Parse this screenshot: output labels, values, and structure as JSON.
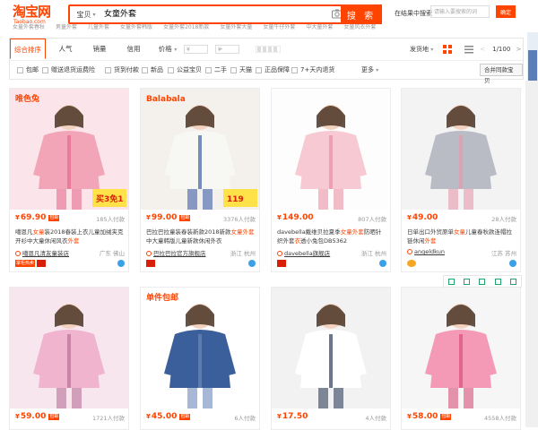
{
  "header": {
    "logo_main": "淘宝网",
    "logo_sub": "Taobao.com",
    "search_type": "宝贝",
    "search_query": "女童外套",
    "search_button": "搜 索",
    "in_results_label": "在结果中搜索",
    "in_results_placeholder": "请输入要搜索的词",
    "confirm": "确定",
    "hot_words": [
      "女童外套春秋",
      "男童外套",
      "儿童外套",
      "女童外套韩版",
      "女童外套2018新款",
      "女童外套大童",
      "女童牛仔外套",
      "中大童外套",
      "女童风衣外套"
    ]
  },
  "sort": {
    "tabs": [
      "综合排序",
      "人气",
      "销量",
      "信用",
      "价格"
    ],
    "price_from": "¥",
    "price_to": "¥",
    "dash": "-",
    "ship_from": "发货地",
    "page": "1/100",
    "prev": "<",
    "next": ">"
  },
  "filters": {
    "checkboxes": [
      "包邮",
      "赠送退货运费险",
      "货到付款",
      "新品",
      "公益宝贝",
      "二手",
      "天猫",
      "正品保障",
      "7+天内退货"
    ],
    "more": "更多",
    "merge": "合并同款宝贝"
  },
  "products": [
    {
      "price": "69.90",
      "free_shipping": "包邮",
      "paid": "185人付款",
      "title_parts": [
        "噶恩凡",
        "女童",
        "装2018春装上衣儿童加绒夹克开衫中大童休闲风衣",
        "外套"
      ],
      "shop": "噶恩凡清友童装店",
      "location": "广东 佛山",
      "badges": [
        "掌柜热卖"
      ],
      "img": {
        "bg": "#fbe5ea",
        "top": "#f3a5b8",
        "accent": "#e56a8f",
        "brand": "唯色兔",
        "promo": "买3免1"
      }
    },
    {
      "price": "99.00",
      "free_shipping": "包邮",
      "paid": "3376人付款",
      "title_parts": [
        "巴拉巴拉童装春装新款2018新款",
        "女童外套",
        "中大童韩版儿童新款休闲外衣",
        ""
      ],
      "shop": "巴拉巴拉官方旗舰店",
      "location": "浙江 杭州",
      "badges": [],
      "img": {
        "bg": "#f4f1ec",
        "top": "#f7f7f4",
        "accent": "#3d5ea8",
        "brand": "Balabala",
        "promo": "119"
      }
    },
    {
      "price": "149.00",
      "free_shipping": "",
      "paid": "807人付款",
      "title_parts": [
        "davebella戴维贝拉夏季",
        "女童外套",
        "防晒针织外套",
        "衣",
        "透小兔包DB5362"
      ],
      "shop": "davebella旗舰店",
      "location": "浙江 杭州",
      "badges": [],
      "img": {
        "bg": "#fdfdfd",
        "top": "#f6c9d3",
        "accent": "#ea8fa3",
        "brand": "",
        "promo": ""
      }
    },
    {
      "price": "49.00",
      "free_shipping": "",
      "paid": "28人付款",
      "title_parts": [
        "日单出口外贸原单",
        "女童",
        "儿童春秋款连帽拉链休闲",
        "外套",
        ""
      ],
      "shop": "angeldkun",
      "location": "江苏 苏州",
      "badges": [],
      "img": {
        "bg": "#f3f3f3",
        "top": "#b9bcc4",
        "accent": "#e69aac",
        "brand": "",
        "promo": ""
      }
    },
    {
      "price": "59.00",
      "free_shipping": "包邮",
      "paid": "1721人付款",
      "img": {
        "bg": "#f8e6ef",
        "top": "#f0b4ce",
        "accent": "#b96f96",
        "brand": "",
        "promo": ""
      }
    },
    {
      "price": "45.00",
      "free_shipping": "包邮",
      "paid": "6人付款",
      "img": {
        "bg": "#ffffff",
        "top": "#3b5f9a",
        "accent": "#6a88bb",
        "brand": "单件包邮",
        "promo": ""
      }
    },
    {
      "price": "17.50",
      "free_shipping": "",
      "paid": "4人付款",
      "img": {
        "bg": "#f2f2f2",
        "top": "#ffffff",
        "accent": "#2f3d5a",
        "brand": "",
        "promo": ""
      }
    },
    {
      "price": "58.00",
      "free_shipping": "包邮",
      "paid": "4558人付款",
      "img": {
        "bg": "#f6f6f6",
        "top": "#f49ab7",
        "accent": "#d94f7c",
        "brand": "",
        "promo": ""
      }
    }
  ]
}
